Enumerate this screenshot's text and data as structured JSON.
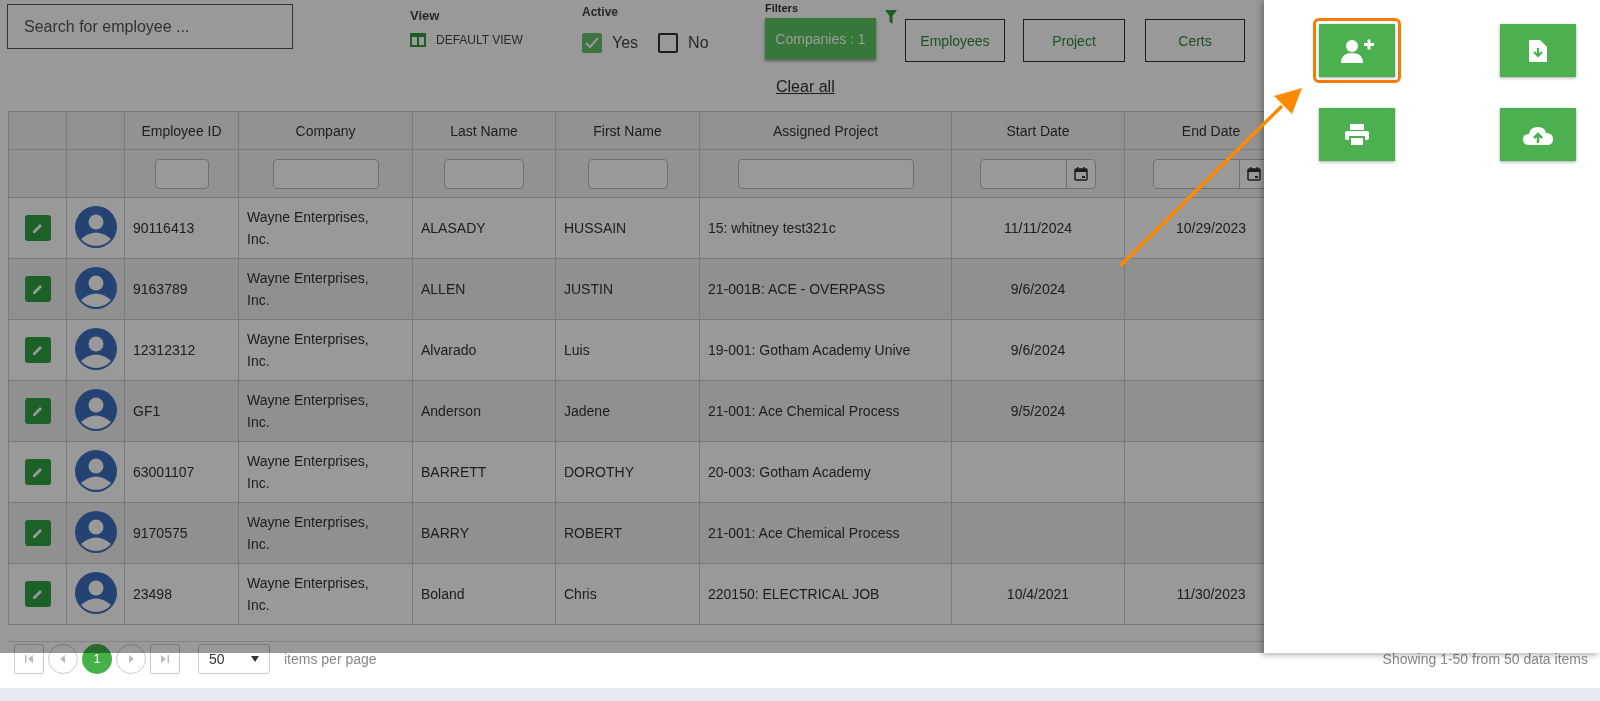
{
  "search": {
    "placeholder": "Search for employee ..."
  },
  "view": {
    "label": "View",
    "value": "DEFAULT VIEW"
  },
  "active": {
    "label": "Active",
    "options": [
      {
        "label": "Yes",
        "checked": true
      },
      {
        "label": "No",
        "checked": false
      }
    ]
  },
  "filters": {
    "label": "Filters",
    "buttons": [
      {
        "label": "Companies : 1",
        "selected": true
      },
      {
        "label": "Employees",
        "selected": false
      },
      {
        "label": "Project",
        "selected": false
      },
      {
        "label": "Certs",
        "selected": false
      }
    ]
  },
  "clear_all": "Clear all",
  "table": {
    "columns": [
      {
        "label": "Employee ID",
        "kind": "text"
      },
      {
        "label": "Company",
        "kind": "text"
      },
      {
        "label": "Last Name",
        "kind": "text"
      },
      {
        "label": "First Name",
        "kind": "text"
      },
      {
        "label": "Assigned Project",
        "kind": "text"
      },
      {
        "label": "Start Date",
        "kind": "date"
      },
      {
        "label": "End Date",
        "kind": "date"
      }
    ],
    "rows": [
      {
        "cells": [
          "90116413",
          "Wayne Enterprises, Inc.",
          "ALASADY",
          "HUSSAIN",
          "15: whitney test321c",
          "11/11/2024",
          "10/29/2023"
        ]
      },
      {
        "cells": [
          "9163789",
          "Wayne Enterprises, Inc.",
          "ALLEN",
          "JUSTIN",
          "21-001B: ACE - OVERPASS",
          "9/6/2024"
        ]
      },
      {
        "cells": [
          "12312312",
          "Wayne Enterprises, Inc.",
          "Alvarado",
          "Luis",
          "19-001: Gotham Academy Unive",
          "9/6/2024"
        ]
      },
      {
        "cells": [
          "GF1",
          "Wayne Enterprises, Inc.",
          "Anderson",
          "Jadene",
          "21-001: Ace Chemical Process",
          "9/5/2024"
        ]
      },
      {
        "cells": [
          "63001107",
          "Wayne Enterprises, Inc.",
          "BARRETT",
          "DOROTHY",
          "20-003: Gotham Academy"
        ]
      },
      {
        "cells": [
          "9170575",
          "Wayne Enterprises, Inc.",
          "BARRY",
          "ROBERT",
          "21-001: Ace Chemical Process"
        ]
      },
      {
        "cells": [
          "23498",
          "Wayne Enterprises, Inc.",
          "Boland",
          "Chris",
          "220150: ELECTRICAL JOB",
          "10/4/2021",
          "11/30/2023"
        ]
      }
    ]
  },
  "pager": {
    "pages": [
      {
        "label": "1",
        "selected": true
      }
    ],
    "page_size": "50",
    "page_size_label": "items per page",
    "summary": "Showing 1-50 from 50 data items"
  },
  "panel": {
    "actions": [
      {
        "kind": "add-user",
        "highlighted": true
      },
      {
        "kind": "download",
        "highlighted": false
      },
      {
        "kind": "print",
        "highlighted": false
      },
      {
        "kind": "upload",
        "highlighted": false
      }
    ]
  },
  "annotation": {
    "kind": "arrow"
  }
}
